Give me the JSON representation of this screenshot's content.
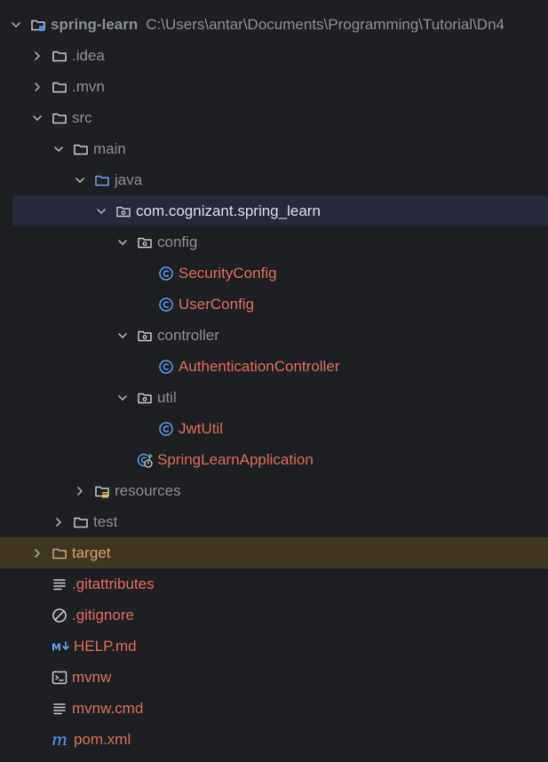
{
  "tree": [
    {
      "depth": 0,
      "expand": "open",
      "icon": "module-folder-icon",
      "label": "spring-learn",
      "path": "C:\\Users\\antar\\Documents\\Programming\\Tutorial\\Dn4",
      "style": "bold grey"
    },
    {
      "depth": 1,
      "expand": "closed",
      "icon": "folder-icon",
      "label": ".idea",
      "style": "grey"
    },
    {
      "depth": 1,
      "expand": "closed",
      "icon": "folder-icon",
      "label": ".mvn",
      "style": "grey"
    },
    {
      "depth": 1,
      "expand": "open",
      "icon": "folder-icon",
      "label": "src",
      "style": "grey"
    },
    {
      "depth": 2,
      "expand": "open",
      "icon": "folder-icon",
      "label": "main",
      "style": "grey"
    },
    {
      "depth": 3,
      "expand": "open",
      "icon": "source-folder-icon",
      "label": "java",
      "style": "grey"
    },
    {
      "depth": 4,
      "expand": "open",
      "icon": "package-icon",
      "label": "com.cognizant.spring_learn",
      "style": "",
      "selected": true
    },
    {
      "depth": 5,
      "expand": "open",
      "icon": "package-icon",
      "label": "config",
      "style": "grey"
    },
    {
      "depth": 6,
      "expand": "none",
      "icon": "class-icon",
      "label": "SecurityConfig",
      "style": "red"
    },
    {
      "depth": 6,
      "expand": "none",
      "icon": "class-icon",
      "label": "UserConfig",
      "style": "red"
    },
    {
      "depth": 5,
      "expand": "open",
      "icon": "package-icon",
      "label": "controller",
      "style": "grey"
    },
    {
      "depth": 6,
      "expand": "none",
      "icon": "class-icon",
      "label": "AuthenticationController",
      "style": "red"
    },
    {
      "depth": 5,
      "expand": "open",
      "icon": "package-icon",
      "label": "util",
      "style": "grey"
    },
    {
      "depth": 6,
      "expand": "none",
      "icon": "class-icon",
      "label": "JwtUtil",
      "style": "red"
    },
    {
      "depth": 5,
      "expand": "none",
      "icon": "spring-app-icon",
      "label": "SpringLearnApplication",
      "style": "red"
    },
    {
      "depth": 3,
      "expand": "closed",
      "icon": "resources-folder-icon",
      "label": "resources",
      "style": "grey"
    },
    {
      "depth": 2,
      "expand": "closed",
      "icon": "folder-icon",
      "label": "test",
      "style": "grey"
    },
    {
      "depth": 1,
      "expand": "closed",
      "icon": "excluded-folder-icon",
      "label": "target",
      "style": "orange",
      "excluded": true
    },
    {
      "depth": 1,
      "expand": "none",
      "icon": "text-file-icon",
      "label": ".gitattributes",
      "style": "red"
    },
    {
      "depth": 1,
      "expand": "none",
      "icon": "ignore-file-icon",
      "label": ".gitignore",
      "style": "red"
    },
    {
      "depth": 1,
      "expand": "none",
      "icon": "markdown-file-icon",
      "label": "HELP.md",
      "style": "red"
    },
    {
      "depth": 1,
      "expand": "none",
      "icon": "shell-script-icon",
      "label": "mvnw",
      "style": "red"
    },
    {
      "depth": 1,
      "expand": "none",
      "icon": "text-file-icon",
      "label": "mvnw.cmd",
      "style": "red"
    },
    {
      "depth": 1,
      "expand": "none",
      "icon": "maven-icon",
      "label": "pom.xml",
      "style": "red"
    }
  ]
}
